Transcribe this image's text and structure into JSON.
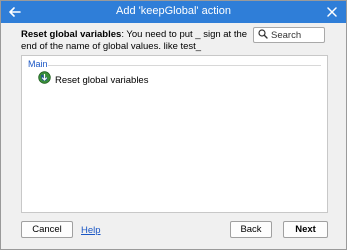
{
  "window": {
    "title": "Add 'keepGlobal' action"
  },
  "description": {
    "bold": "Reset global variables",
    "rest": ": You need to put _ sign at the end of the name of global values. like test_"
  },
  "search": {
    "placeholder": "Search"
  },
  "panel": {
    "group_label": "Main",
    "items": [
      {
        "label": "Reset global variables"
      }
    ]
  },
  "footer": {
    "cancel_label": "Cancel",
    "help_label": "Help",
    "back_label": "Back",
    "next_label": "Next"
  },
  "colors": {
    "titlebar": "#2f7ed8",
    "link": "#1a56c4"
  },
  "icons": {
    "back": "back-arrow-icon",
    "close": "close-icon",
    "search": "search-icon",
    "item": "globe-icon"
  }
}
